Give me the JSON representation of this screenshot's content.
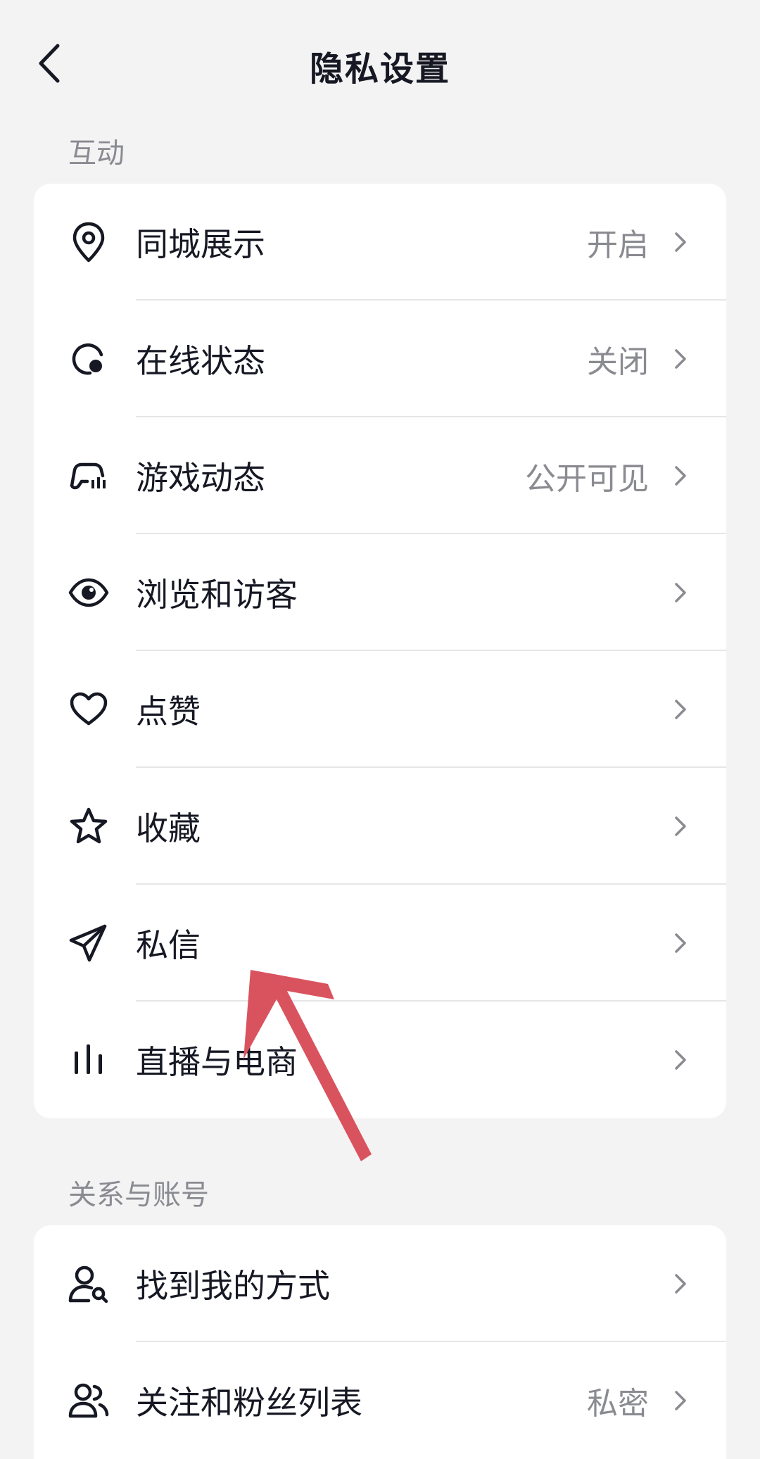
{
  "header": {
    "title": "隐私设置"
  },
  "sections": [
    {
      "title": "互动",
      "items": [
        {
          "icon": "location-pin-icon",
          "label": "同城展示",
          "value": "开启"
        },
        {
          "icon": "online-status-icon",
          "label": "在线状态",
          "value": "关闭"
        },
        {
          "icon": "gamepad-icon",
          "label": "游戏动态",
          "value": "公开可见"
        },
        {
          "icon": "eye-icon",
          "label": "浏览和访客",
          "value": ""
        },
        {
          "icon": "heart-icon",
          "label": "点赞",
          "value": ""
        },
        {
          "icon": "star-icon",
          "label": "收藏",
          "value": ""
        },
        {
          "icon": "send-icon",
          "label": "私信",
          "value": ""
        },
        {
          "icon": "bar-chart-icon",
          "label": "直播与电商",
          "value": ""
        }
      ]
    },
    {
      "title": "关系与账号",
      "items": [
        {
          "icon": "user-search-icon",
          "label": "找到我的方式",
          "value": ""
        },
        {
          "icon": "users-icon",
          "label": "关注和粉丝列表",
          "value": "私密"
        }
      ]
    }
  ],
  "colors": {
    "background": "#f3f3f4",
    "card": "#ffffff",
    "text_primary": "#161823",
    "text_secondary": "#8a8b91",
    "annotation_arrow": "#d9535f"
  }
}
